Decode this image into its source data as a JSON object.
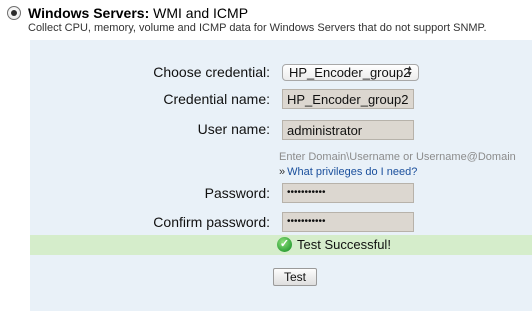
{
  "section": {
    "title_bold": "Windows Servers:",
    "title_rest": " WMI and ICMP",
    "subtitle": "Collect CPU, memory, volume and ICMP data for Windows Servers that do not support SNMP."
  },
  "form": {
    "choose_credential_label": "Choose credential:",
    "choose_credential_value": "HP_Encoder_group2",
    "credential_name_label": "Credential name:",
    "credential_name_value": "HP_Encoder_group2",
    "user_name_label": "User name:",
    "user_name_value": "administrator",
    "user_name_hint": "Enter Domain\\Username or Username@Domain",
    "help_arrow": "»",
    "help_link": "What privileges do I need?",
    "password_label": "Password:",
    "password_value": "•••••••••••",
    "confirm_password_label": "Confirm password:",
    "confirm_password_value": "•••••••••••"
  },
  "status": {
    "message": "Test Successful!",
    "icon": "checkmark-icon",
    "bar_color": "#d5edcb"
  },
  "actions": {
    "test_label": "Test"
  }
}
